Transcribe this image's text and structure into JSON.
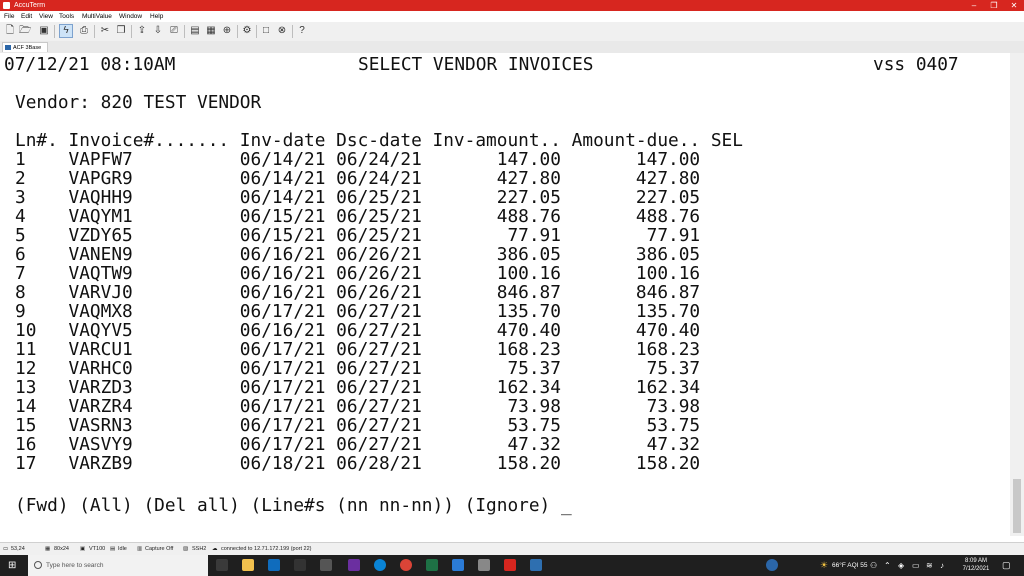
{
  "window": {
    "title": "AccuTerm",
    "minimize": "–",
    "maximize": "❐",
    "close": "✕"
  },
  "menu": [
    "File",
    "Edit",
    "View",
    "Tools",
    "MultiValue",
    "Window",
    "Help"
  ],
  "toolbar_icons": [
    "new-icon",
    "open-icon",
    "save-icon",
    "connect-icon",
    "print-icon",
    "cut-icon",
    "copy-icon",
    "paste-icon",
    "upload-icon",
    "download-icon",
    "printer-icon",
    "file-icon",
    "image-icon",
    "key-icon",
    "settings-icon",
    "window-icon",
    "close-icon",
    "help-icon"
  ],
  "tab": {
    "label": "ACF 3Base"
  },
  "screen": {
    "datetime": "07/12/21 08:10AM",
    "title": "SELECT VENDOR INVOICES",
    "code": "vss 0407",
    "vendor": "Vendor: 820 TEST VENDOR",
    "header": "Ln#. Invoice#....... Inv-date Dsc-date Inv-amount.. Amount-due.. SEL",
    "rows": [
      "1    VAPFW7          06/14/21 06/24/21       147.00       147.00",
      "2    VAPGR9          06/14/21 06/24/21       427.80       427.80",
      "3    VAQHH9          06/14/21 06/25/21       227.05       227.05",
      "4    VAQYM1          06/15/21 06/25/21       488.76       488.76",
      "5    VZDY65          06/15/21 06/25/21        77.91        77.91",
      "6    VANEN9          06/16/21 06/26/21       386.05       386.05",
      "7    VAQTW9          06/16/21 06/26/21       100.16       100.16",
      "8    VARVJ0          06/16/21 06/26/21       846.87       846.87",
      "9    VAQMX8          06/17/21 06/27/21       135.70       135.70",
      "10   VAQYV5          06/16/21 06/27/21       470.40       470.40",
      "11   VARCU1          06/17/21 06/27/21       168.23       168.23",
      "12   VARHC0          06/17/21 06/27/21        75.37        75.37",
      "13   VARZD3          06/17/21 06/27/21       162.34       162.34",
      "14   VARZR4          06/17/21 06/27/21        73.98        73.98",
      "15   VASRN3          06/17/21 06/27/21        53.75        53.75",
      "16   VASVY9          06/17/21 06/27/21        47.32        47.32",
      "17   VARZB9          06/18/21 06/28/21       158.20       158.20"
    ],
    "prompt": "(Fwd) (All) (Del all) (Line#s (nn nn-nn)) (Ignore) _"
  },
  "status": {
    "cursor": "53,24",
    "size": "80x24",
    "emulation": "VT100",
    "state": "Idle",
    "capture": "Capture Off",
    "protocol": "SSH2",
    "connection": "connected to 12.71.172.199 (port 22)"
  },
  "taskbar": {
    "search_placeholder": "Type here to search",
    "weather": "66°F  AQI 55",
    "time": "8:09 AM",
    "date": "7/12/2021"
  }
}
